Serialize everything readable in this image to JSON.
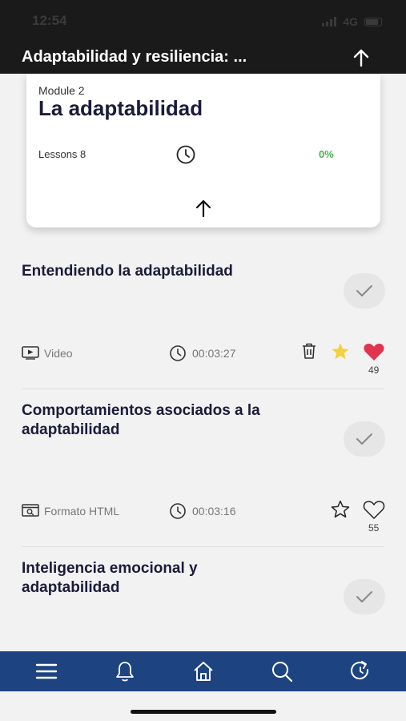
{
  "status": {
    "time": "12:54",
    "network": "4G"
  },
  "header": {
    "title": "Adaptabilidad y resiliencia: ...",
    "collapse_icon": "arrow-up-icon"
  },
  "module": {
    "label": "Module 2",
    "title": "La adaptabilidad",
    "lessons": "Lessons 8",
    "progress": "0%",
    "progress_value": 0,
    "progress_color": "#4caf50"
  },
  "lessons": [
    {
      "title": "Entendiendo la adaptabilidad",
      "type": "Video",
      "type_icon": "video-icon",
      "duration": "00:03:27",
      "has_delete": true,
      "favorited": true,
      "liked": true,
      "likes": "49",
      "completed": false
    },
    {
      "title": "Comportamientos asociados a la adaptabilidad",
      "type": "Formato HTML",
      "type_icon": "html-format-icon",
      "duration": "00:03:16",
      "has_delete": false,
      "favorited": false,
      "liked": false,
      "likes": "55",
      "completed": false
    },
    {
      "title": "Inteligencia emocional y adaptabilidad",
      "completed": false
    }
  ],
  "nav": [
    "menu-icon",
    "bell-icon",
    "home-icon",
    "search-icon",
    "refresh-icon"
  ],
  "colors": {
    "nav_bg": "#1d4480",
    "title": "#1b1b3a",
    "heart": "#e0344f",
    "star": "#f4d03f",
    "header_bg": "#1a1a1a"
  }
}
